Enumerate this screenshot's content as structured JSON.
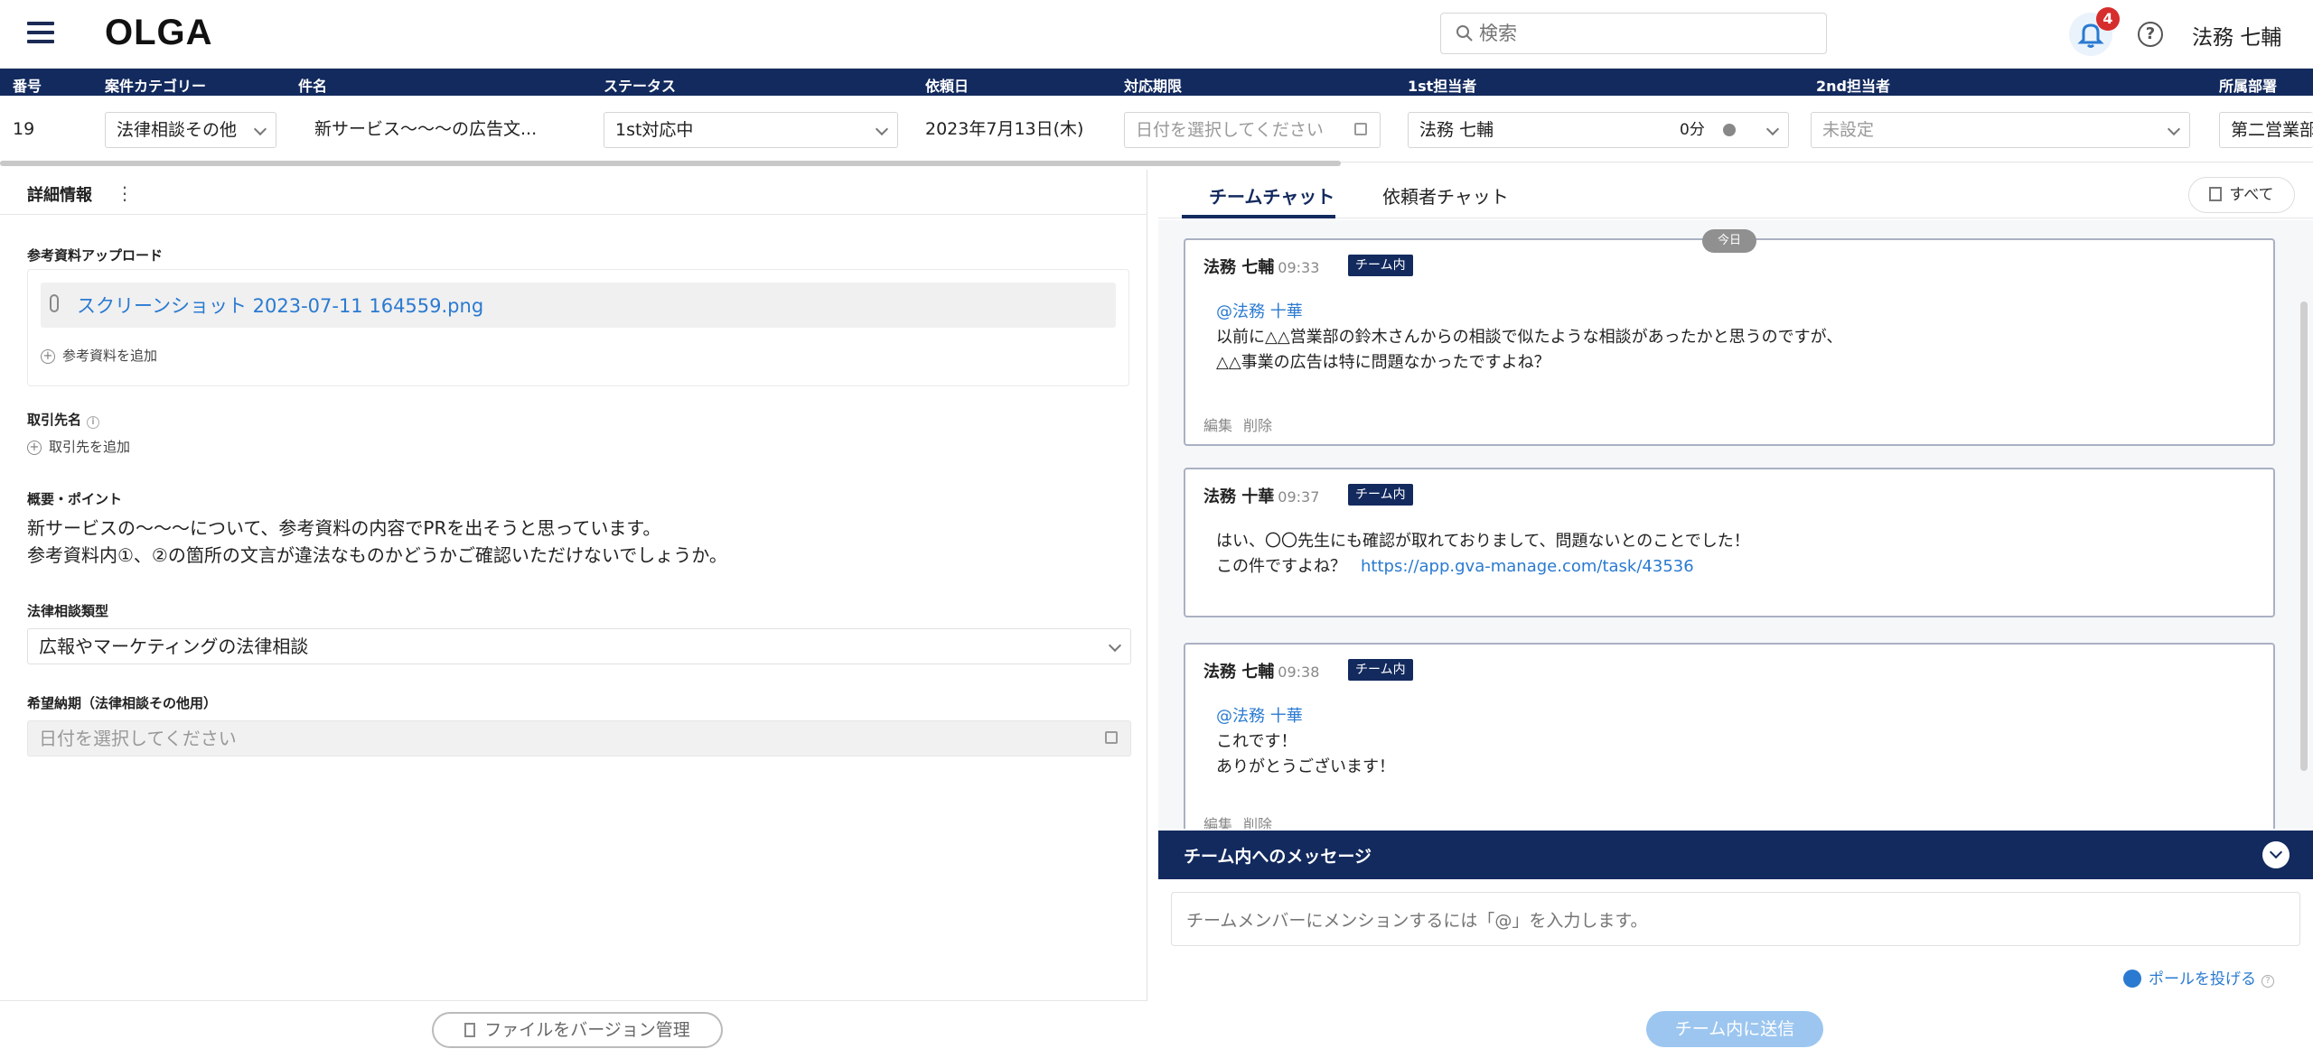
{
  "app": {
    "logo": "OLGA"
  },
  "header": {
    "search_placeholder": "検索",
    "notification_count": "4",
    "help_symbol": "?",
    "user_name": "法務 七輔"
  },
  "table": {
    "columns": [
      "番号",
      "案件カテゴリー",
      "件名",
      "ステータス",
      "依頼日",
      "対応期限",
      "1st担当者",
      "2nd担当者",
      "所属部署"
    ],
    "row": {
      "number": "19",
      "category": "法律相談その他",
      "subject": "新サービス〜〜〜の広告文...",
      "status": "1st対応中",
      "request_date": "2023年7月13日(木)",
      "deadline_placeholder": "日付を選択してください",
      "first_assignee": "法務 七輔",
      "first_assignee_time": "0分",
      "second_assignee": "未設定",
      "department": "第二営業部"
    }
  },
  "detail": {
    "title": "詳細情報",
    "kebab": "⋮",
    "upload_label": "参考資料アップロード",
    "file_name": "スクリーンショット 2023-07-11 164559.png",
    "add_reference": "参考資料を追加",
    "client_label": "取引先名",
    "add_client": "取引先を追加",
    "summary_label": "概要・ポイント",
    "summary_lines": [
      "新サービスの〜〜〜について、参考資料の内容でPRを出そうと思っています。",
      "参考資料内①、②の箇所の文言が違法なものかどうかご確認いただけないでしょうか。"
    ],
    "consult_type_label": "法律相談類型",
    "consult_type_value": "広報やマーケティングの法律相談",
    "desired_date_label": "希望納期（法律相談その他用）",
    "desired_date_placeholder": "日付を選択してください",
    "version_button": "ファイルをバージョン管理"
  },
  "chat": {
    "tabs": [
      "チームチャット",
      "依頼者チャット"
    ],
    "all_button": "すべて",
    "today_label": "今日",
    "messages": [
      {
        "author": "法務 七輔",
        "time": "09:33",
        "tag": "チーム内",
        "mention": "@法務 十華",
        "lines": [
          "以前に△△営業部の鈴木さんからの相談で似たような相談があったかと思うのですが、",
          "△△事業の広告は特に問題なかったですよね？"
        ],
        "actions": [
          "編集",
          "削除"
        ]
      },
      {
        "author": "法務 十華",
        "time": "09:37",
        "tag": "チーム内",
        "lines": [
          "はい、〇〇先生にも確認が取れておりまして、問題ないとのことでした！",
          "この件ですよね？"
        ],
        "link": "https://app.gva-manage.com/task/43536"
      },
      {
        "author": "法務 七輔",
        "time": "09:38",
        "tag": "チーム内",
        "mention": "@法務 十華",
        "lines": [
          "これです！",
          "ありがとうございます！"
        ],
        "actions": [
          "編集",
          "削除"
        ]
      }
    ],
    "compose_title": "チーム内へのメッセージ",
    "compose_placeholder": "チームメンバーにメンションするには「@」を入力します。",
    "poll_label": "ポールを投げる",
    "send_button": "チーム内に送信"
  }
}
